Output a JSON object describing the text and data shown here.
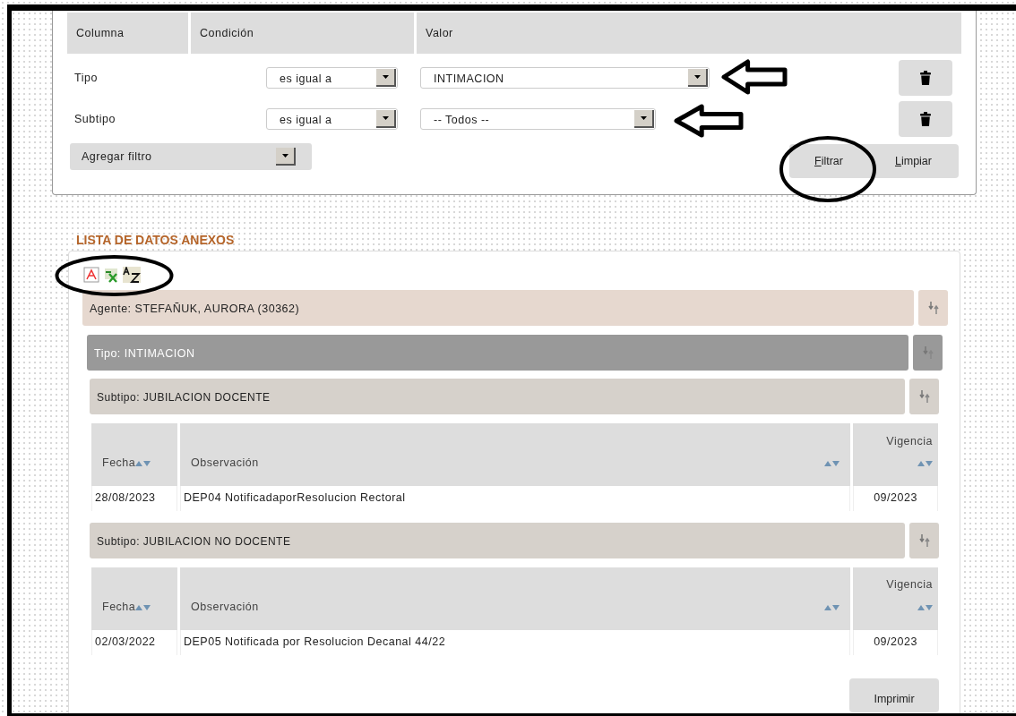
{
  "filter": {
    "columns": [
      "Columna",
      "Condición",
      "Valor"
    ],
    "rows": [
      {
        "column": "Tipo",
        "condition": "es igual a",
        "value": "INTIMACION"
      },
      {
        "column": "Subtipo",
        "condition": "es igual a",
        "value": "-- Todos --"
      }
    ],
    "add_filter": "Agregar filtro",
    "buttons": [
      {
        "label": "Filtrar"
      },
      {
        "label": "Limpiar"
      }
    ]
  },
  "list": {
    "title": "LISTA DE DATOS ANEXOS",
    "groups": [
      {
        "kind": "agente",
        "label": "Agente: STEFAÑUK, AURORA (30362)",
        "children": [
          {
            "kind": "tipo",
            "label": "Tipo: INTIMACION",
            "children": [
              {
                "kind": "subtipo",
                "label": "Subtipo: JUBILACION DOCENTE",
                "table": {
                  "columns": [
                    "Fecha",
                    "Observación",
                    "Vigencia"
                  ],
                  "rows": [
                    [
                      "28/08/2023",
                      "DEP04 NotificadaporResolucion Rectoral",
                      "09/2023"
                    ]
                  ]
                }
              },
              {
                "kind": "subtipo",
                "label": "Subtipo: JUBILACION NO DOCENTE",
                "table": {
                  "columns": [
                    "Fecha",
                    "Observación",
                    "Vigencia"
                  ],
                  "rows": [
                    [
                      "02/03/2022",
                      "DEP05 Notificada por Resolucion Decanal 44/22",
                      "09/2023"
                    ]
                  ]
                }
              }
            ]
          }
        ]
      }
    ]
  },
  "print_button": "Imprimir"
}
